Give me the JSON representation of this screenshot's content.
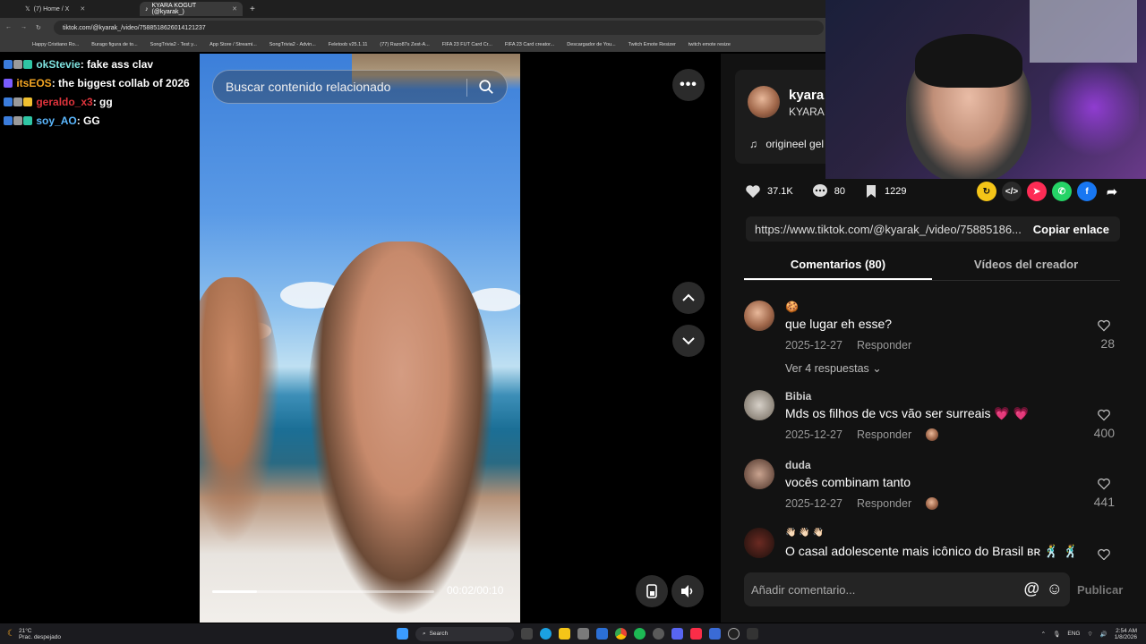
{
  "browser": {
    "tabs": [
      {
        "label": "(7) Home / X",
        "active": false
      },
      {
        "label": "KYARA KOGUT (@kyarak_)",
        "active": true
      }
    ],
    "url": "tiktok.com/@kyarak_/video/7588518626014121237",
    "bookmarks": [
      "Happy Cristiano Ro...",
      "Burago figura de to...",
      "SongTrivia2 - Test y...",
      "App Store / Streami...",
      "SongTrivia2 - Advin...",
      "Feletoob v25.1.11",
      "(77) Razo87s Zest-A...",
      "FIFA 23 FUT Card Cr...",
      "FIFA 23 Card creator...",
      "Descargador de You...",
      "Twitch Emote Resizer",
      "twitch emote resize"
    ]
  },
  "chat": [
    {
      "user": "okStevie",
      "msg": ": fake ass clav",
      "color": "#7fe3e0"
    },
    {
      "user": "itsEOS",
      "msg": ": the biggest collab of 2026",
      "color": "#f5a623"
    },
    {
      "user": "geraldo_x3",
      "msg": ": gg",
      "color": "#e0343c"
    },
    {
      "user": "soy_AO",
      "msg": ": GG",
      "color": "#5bb8ff"
    }
  ],
  "video": {
    "search_placeholder": "Buscar contenido relacionado",
    "time": "00:02/00:10",
    "progress": 0.2
  },
  "profile": {
    "username": "kyara",
    "display": "KYARA",
    "music": "originеel gel"
  },
  "actions": {
    "likes": "37.1K",
    "comments": "80",
    "saves": "1229"
  },
  "link": {
    "url": "https://www.tiktok.com/@kyarak_/video/75885186...",
    "copy_label": "Copiar enlace"
  },
  "tabs": {
    "comments": "Comentarios (80)",
    "creator": "Vídeos del creador"
  },
  "comments": [
    {
      "name": "🍪",
      "text": "que lugar eh esse?",
      "date": "2025-12-27",
      "reply": "Responder",
      "likes": "28",
      "replies": "Ver 4 respuestas"
    },
    {
      "name": "Bibia",
      "text": "Mds os filhos de vcs vão ser surreais 💗 💗",
      "date": "2025-12-27",
      "reply": "Responder",
      "likes": "400"
    },
    {
      "name": "duda",
      "text": "vocês combinam tanto",
      "date": "2025-12-27",
      "reply": "Responder",
      "likes": "441"
    },
    {
      "name": "👋🏻 👋🏻 👋🏻",
      "text": "O casal adolescente mais icônico do Brasil ʙʀ 🕺 🕺",
      "date": "",
      "reply": "",
      "likes": ""
    }
  ],
  "composer": {
    "placeholder": "Añadir comentario...",
    "at": "@",
    "publish": "Publicar"
  },
  "taskbar": {
    "weather": "21°C",
    "weather_desc": "Prac. despejado",
    "search": "Search",
    "lang": "ENG",
    "time": "2:54 AM",
    "date": "1/8/2026"
  }
}
